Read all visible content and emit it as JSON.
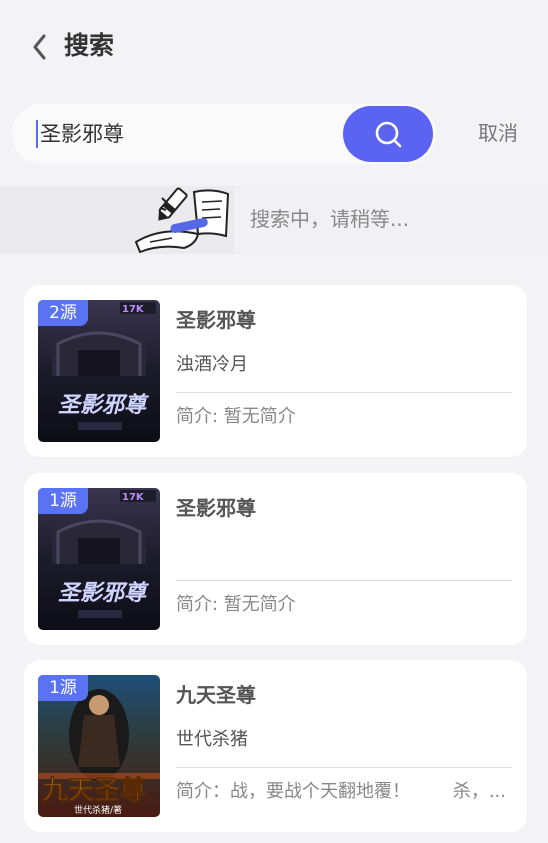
{
  "header": {
    "title": "搜索"
  },
  "search": {
    "query": "圣影邪尊",
    "cancel_label": "取消"
  },
  "status": {
    "text": "搜索中，请稍等..."
  },
  "results": [
    {
      "source": "2源",
      "title": "圣影邪尊",
      "author": "浊酒冷月",
      "intro": "简介: 暂无简介",
      "cover_text": "圣影邪尊"
    },
    {
      "source": "1源",
      "title": "圣影邪尊",
      "author": "",
      "intro": "简介: 暂无简介",
      "cover_text": "圣影邪尊"
    },
    {
      "source": "1源",
      "title": "九天圣尊",
      "author": "世代杀猪",
      "intro": "简介：战，要战个天翻地覆！",
      "intro_tail": "杀，...",
      "cover_text": "九天圣尊",
      "cover_author": "世代杀猪/著"
    }
  ],
  "colors": {
    "accent": "#5a63f2",
    "badge": "#5a73f5",
    "background": "#f3f3f5",
    "card": "#ffffff"
  }
}
